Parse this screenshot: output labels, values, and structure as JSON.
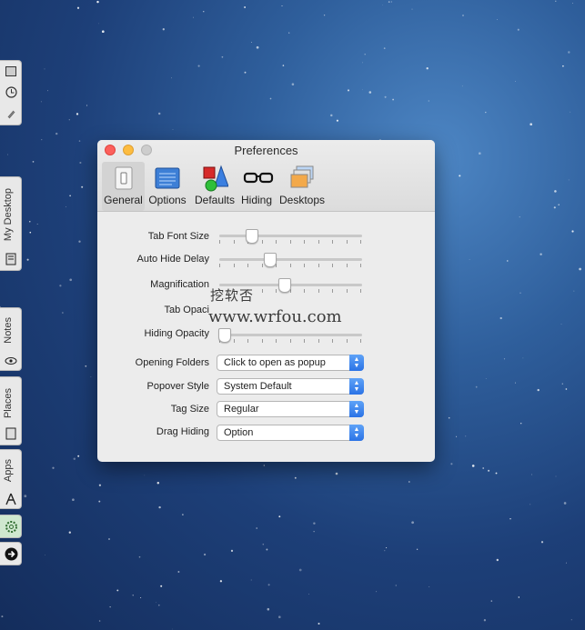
{
  "window": {
    "title": "Preferences"
  },
  "toolbar": [
    {
      "label": "General",
      "icon": "switch-icon"
    },
    {
      "label": "Options",
      "icon": "options-panel-icon"
    },
    {
      "label": "Defaults",
      "icon": "shapes-icon"
    },
    {
      "label": "Hiding",
      "icon": "glasses-icon"
    },
    {
      "label": "Desktops",
      "icon": "desktops-icon"
    }
  ],
  "sliders": [
    {
      "label": "Tab Font Size",
      "level": 0.22
    },
    {
      "label": "Auto Hide Delay",
      "level": 0.35
    },
    {
      "label": "Magnification",
      "level": 0.45
    },
    {
      "label": "Tab Opaci",
      "level": 0.0
    },
    {
      "label": "Hiding Opacity",
      "level": 0.03
    }
  ],
  "popups": [
    {
      "label": "Opening Folders",
      "value": "Click to open as popup"
    },
    {
      "label": "Popover Style",
      "value": "System Default"
    },
    {
      "label": "Tag Size",
      "value": "Regular"
    },
    {
      "label": "Drag Hiding",
      "value": "Option"
    }
  ],
  "watermark": {
    "line1": "挖软否",
    "line2": "www.wrfou.com"
  },
  "side_dock": {
    "tabs": [
      "My Desktop",
      "Notes",
      "Places",
      "Apps"
    ]
  }
}
